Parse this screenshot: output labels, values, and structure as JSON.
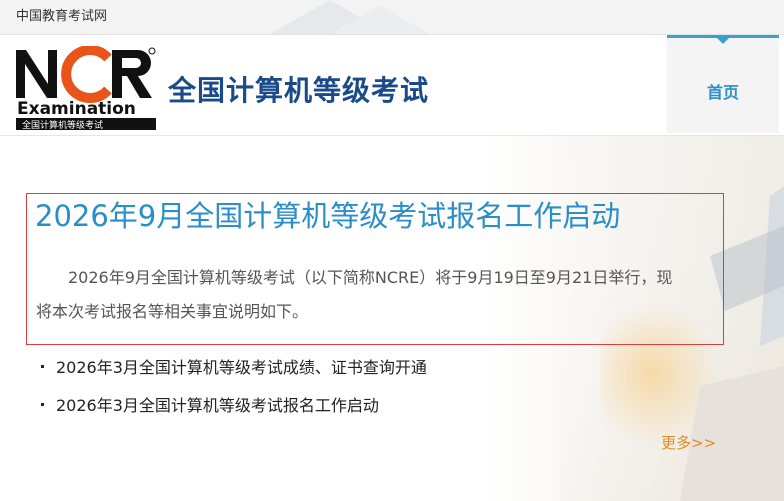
{
  "topbar": {
    "site_name": "中国教育考试网"
  },
  "header": {
    "logo_text": "NCR",
    "logo_sub": "Examination",
    "logo_band": "全国计算机等级考试",
    "title": "全国计算机等级考试",
    "nav_home": "首页"
  },
  "featured": {
    "headline": "2026年9月全国计算机等级考试报名工作启动",
    "summary": "2026年9月全国计算机等级考试（以下简称NCRE）将于9月19日至9月21日举行，现将本次考试报名等相关事宜说明如下。"
  },
  "news": [
    {
      "title": "2026年3月全国计算机等级考试成绩、证书查询开通"
    },
    {
      "title": "2026年3月全国计算机等级考试报名工作启动"
    }
  ],
  "more_label": "更多>>",
  "colors": {
    "accent_blue": "#2a8ec8",
    "title_navy": "#1a4a8a",
    "logo_orange": "#e8541a",
    "more_orange": "#e88a1a",
    "box_red": "#e03b3b"
  }
}
